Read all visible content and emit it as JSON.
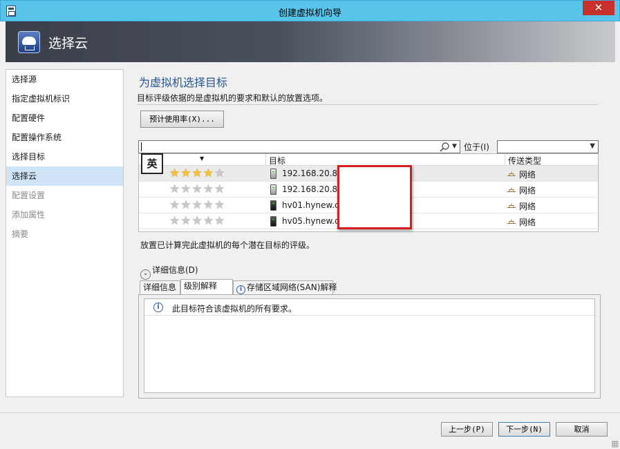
{
  "window": {
    "title": "创建虚拟机向导",
    "close_label": "✕"
  },
  "banner": {
    "title": "选择云"
  },
  "nav": {
    "items": [
      {
        "label": "选择源"
      },
      {
        "label": "指定虚拟机标识"
      },
      {
        "label": "配置硬件"
      },
      {
        "label": "配置操作系统"
      },
      {
        "label": "选择目标"
      },
      {
        "label": "选择云",
        "state": "active"
      },
      {
        "label": "配置设置",
        "state": "disabled"
      },
      {
        "label": "添加属性",
        "state": "disabled"
      },
      {
        "label": "摘要",
        "state": "disabled"
      }
    ]
  },
  "main": {
    "heading": "为虚拟机选择目标",
    "description": "目标评级依据的是虚拟机的要求和默认的放置选项。",
    "estimate_button": "预计使用率(X)...",
    "search": {
      "value": ""
    },
    "in_label": "位于(I)",
    "location_select": {
      "value": ""
    },
    "ime_label": "英",
    "columns": {
      "rating": "",
      "target": "目标",
      "transfer": "传送类型"
    },
    "rows": [
      {
        "stars": 4,
        "host": "192.168.20.85",
        "host_icon": "server-light-icon",
        "transfer": "网络"
      },
      {
        "stars": 0,
        "host": "192.168.20.83",
        "host_icon": "server-light-icon",
        "transfer": "网络"
      },
      {
        "stars": 0,
        "host": "hv01.hynew.co",
        "host_icon": "server-dark-icon",
        "transfer": "网络"
      },
      {
        "stars": 0,
        "host": "hv05.hynew.co",
        "host_icon": "server-dark-icon",
        "transfer": "网络"
      }
    ],
    "status": "放置已计算完此虚拟机的每个潜在目标的评级。",
    "details_expander": "详细信息(D)",
    "tabs": [
      {
        "label": "详细信息"
      },
      {
        "label": "级别解释",
        "state": "active"
      },
      {
        "label": "存储区域网络(SAN)解释",
        "icon": "info-icon"
      }
    ],
    "tab_message": "此目标符合该虚拟机的所有要求。"
  },
  "footer": {
    "prev": "上一步(P)",
    "next": "下一步(N)",
    "cancel": "取消"
  },
  "colors": {
    "titlebar": "#58c4ea",
    "close": "#c7302b",
    "heading": "#24558f",
    "nav_active": "#cfe4f7",
    "redaction": "#d61d1d",
    "star_on": "#f6c030"
  }
}
